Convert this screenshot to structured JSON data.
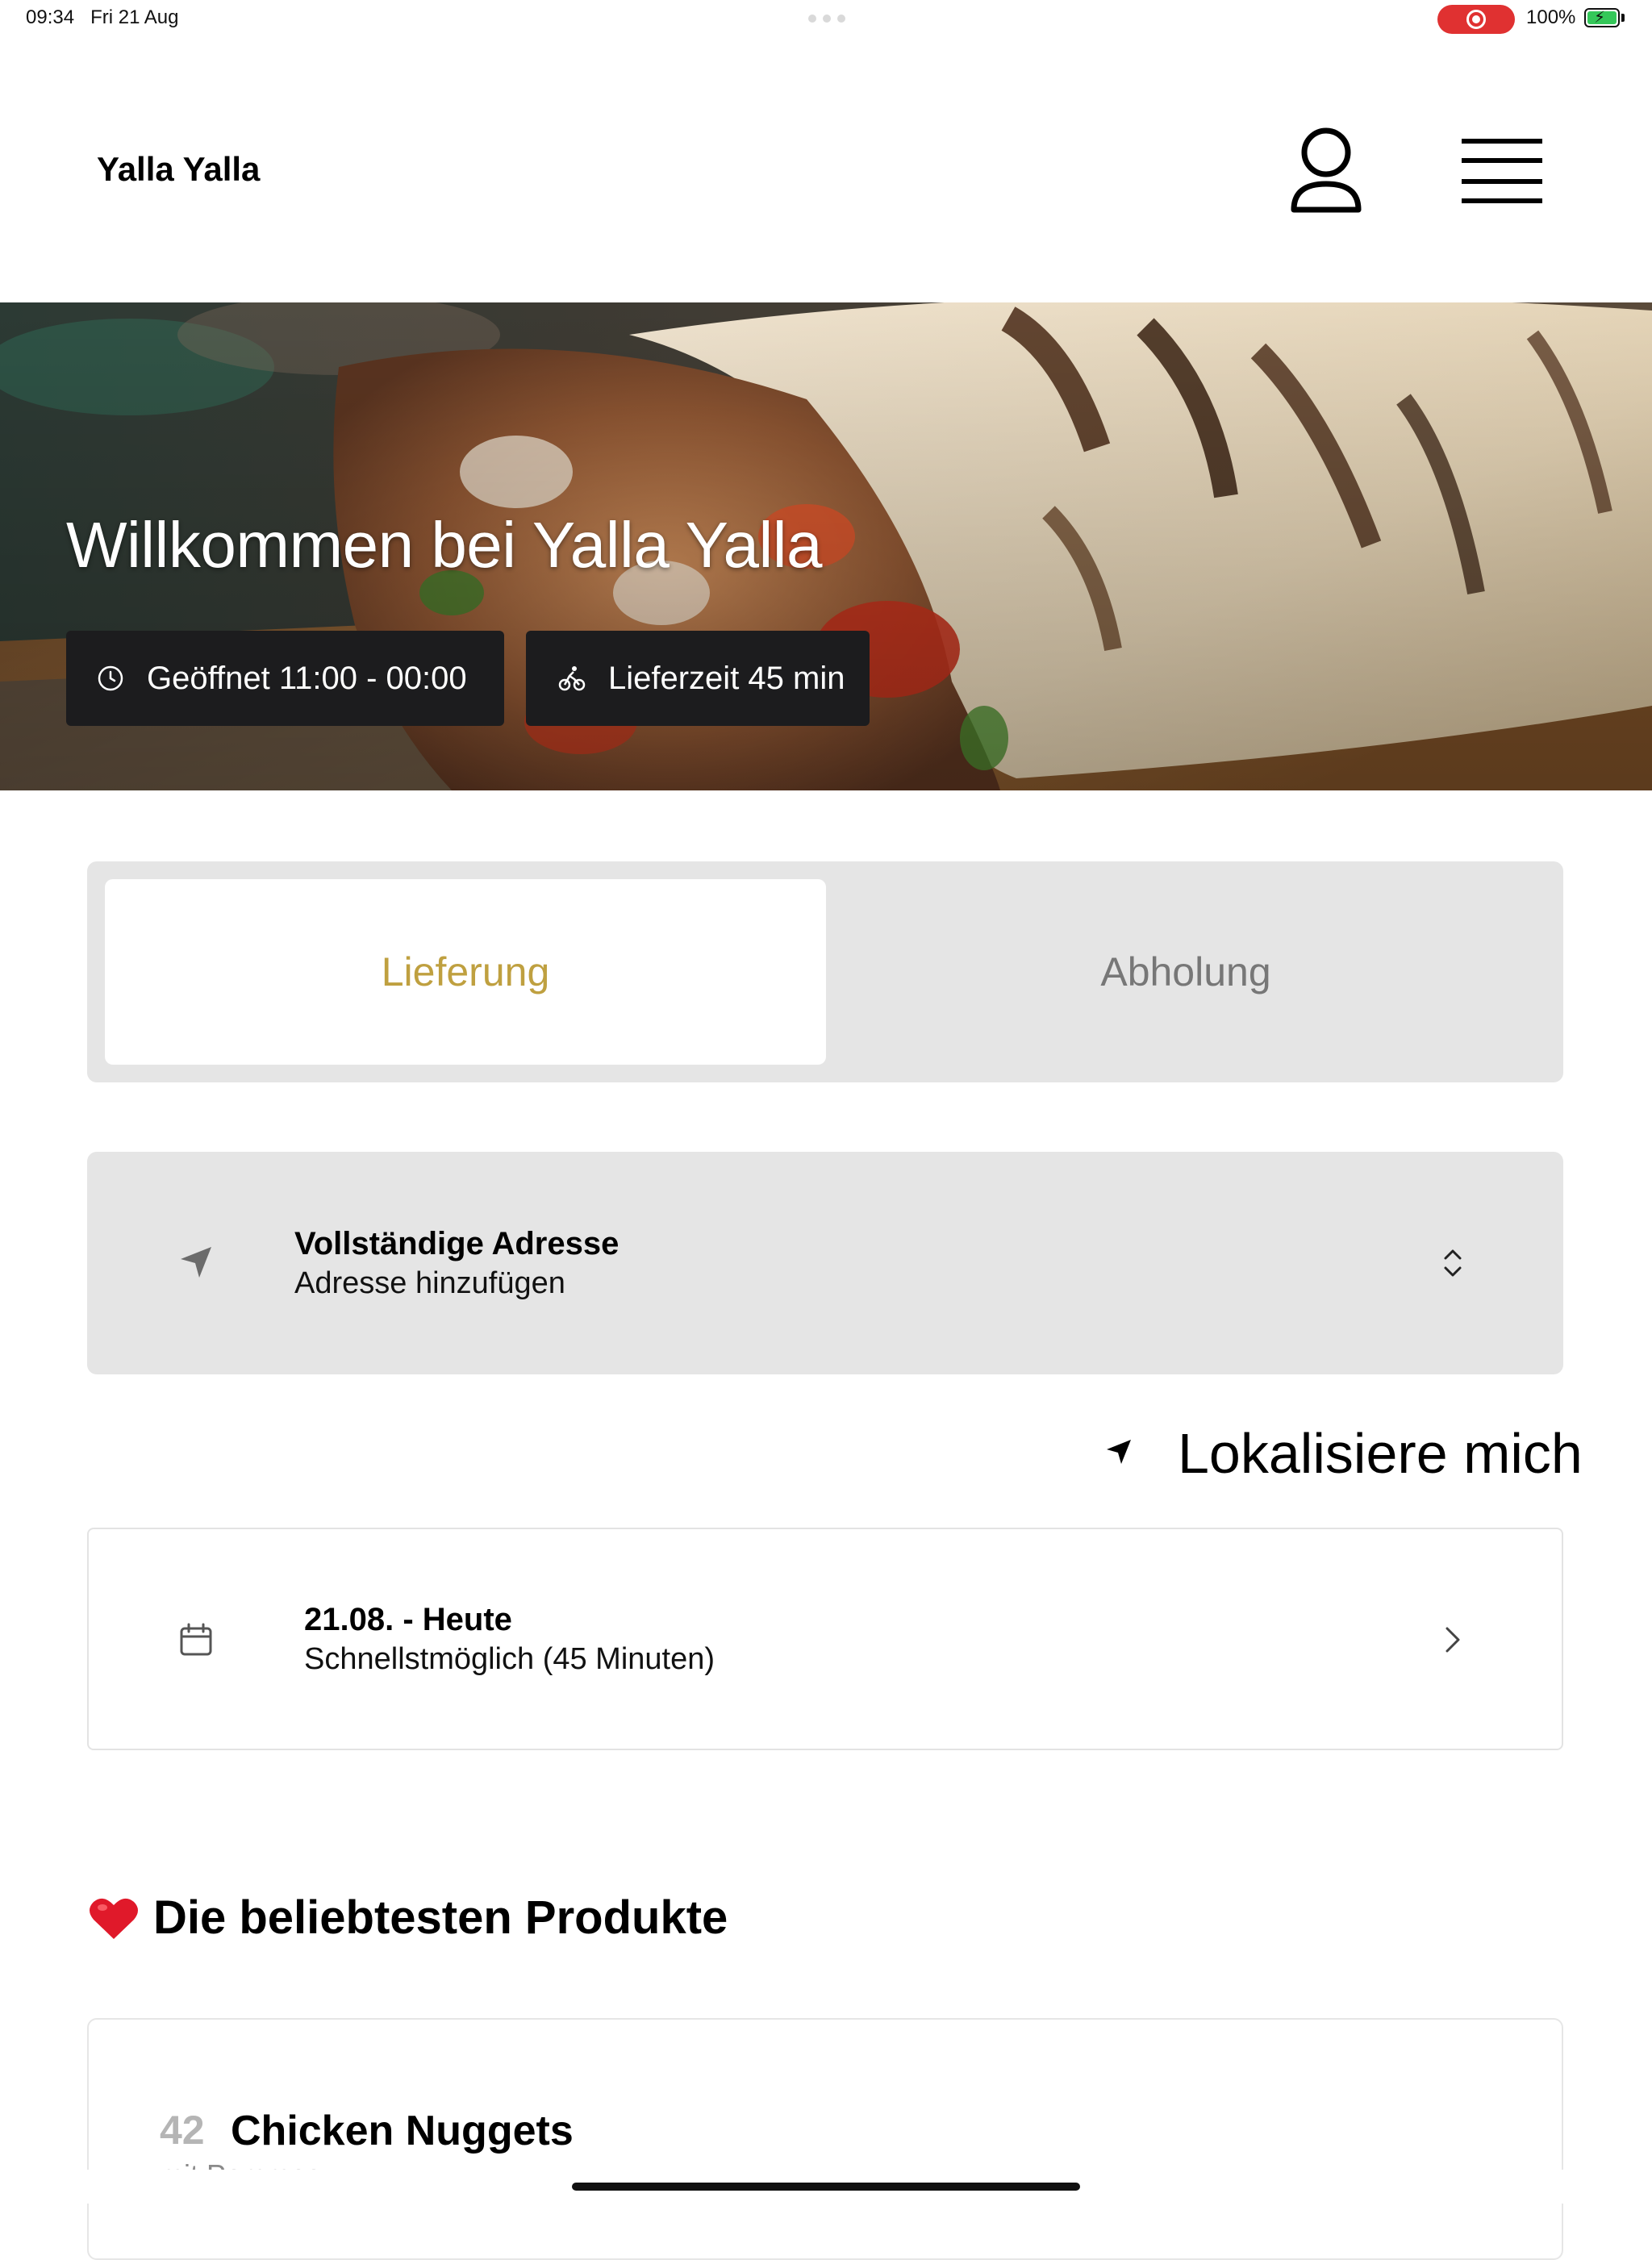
{
  "status_bar": {
    "time": "09:34",
    "date": "Fri 21 Aug",
    "battery_percent": "100%",
    "recording": true,
    "battery_color": "#34c759"
  },
  "header": {
    "brand": "Yalla Yalla",
    "profile_icon": "person-icon",
    "menu_icon": "hamburger-menu-icon"
  },
  "hero": {
    "title": "Willkommen bei Yalla Yalla",
    "opening_hours": "Geöffnet 11:00 - 00:00",
    "delivery_time": "Lieferzeit 45 min",
    "clock_icon": "clock-icon",
    "bike_icon": "bicycle-icon"
  },
  "order_mode": {
    "options": [
      "Lieferung",
      "Abholung"
    ],
    "selected": "Lieferung",
    "accent_color": "#bfa040"
  },
  "address": {
    "title": "Vollständige Adresse",
    "placeholder": "Adresse hinzufügen",
    "icon": "location-arrow-icon"
  },
  "locate": {
    "label": "Lokalisiere mich"
  },
  "schedule": {
    "title": "21.08. - Heute",
    "subtitle": "Schnellstmöglich (45 Minuten)",
    "icon": "calendar-icon"
  },
  "popular": {
    "heading": "Die beliebtesten Produkte",
    "icon": "heart-icon",
    "items": [
      {
        "number": "42",
        "name": "Chicken Nuggets",
        "subtitle": "mit Pommes"
      }
    ]
  }
}
